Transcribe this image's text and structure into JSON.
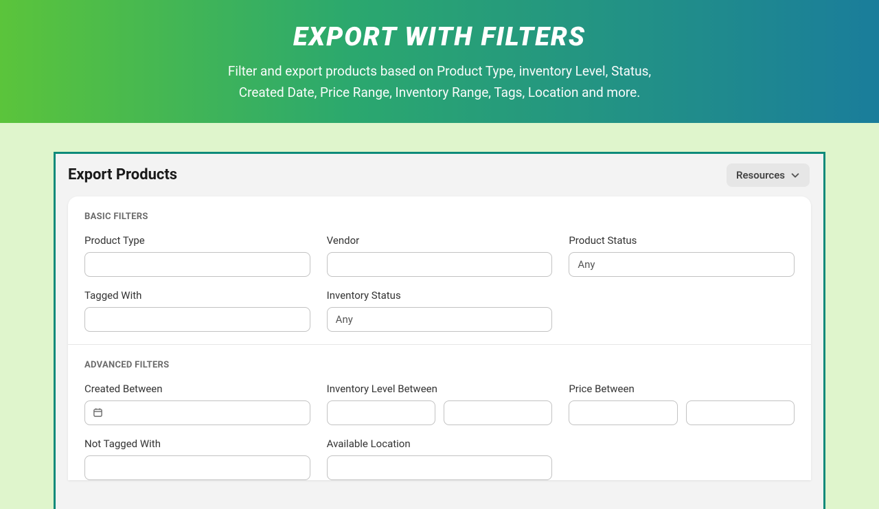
{
  "banner": {
    "title": "EXPORT WITH FILTERS",
    "subtitle_line1": "Filter and export products based on Product Type, inventory Level, Status,",
    "subtitle_line2": "Created Date, Price Range, Inventory Range, Tags, Location and more."
  },
  "header": {
    "title": "Export Products",
    "resources_label": "Resources"
  },
  "sections": {
    "basic": {
      "heading": "BASIC FILTERS",
      "product_type_label": "Product Type",
      "vendor_label": "Vendor",
      "product_status_label": "Product Status",
      "product_status_value": "Any",
      "tagged_with_label": "Tagged With",
      "inventory_status_label": "Inventory Status",
      "inventory_status_value": "Any"
    },
    "advanced": {
      "heading": "ADVANCED FILTERS",
      "created_between_label": "Created Between",
      "inventory_level_between_label": "Inventory Level Between",
      "price_between_label": "Price Between",
      "not_tagged_with_label": "Not Tagged With",
      "available_location_label": "Available Location"
    }
  }
}
